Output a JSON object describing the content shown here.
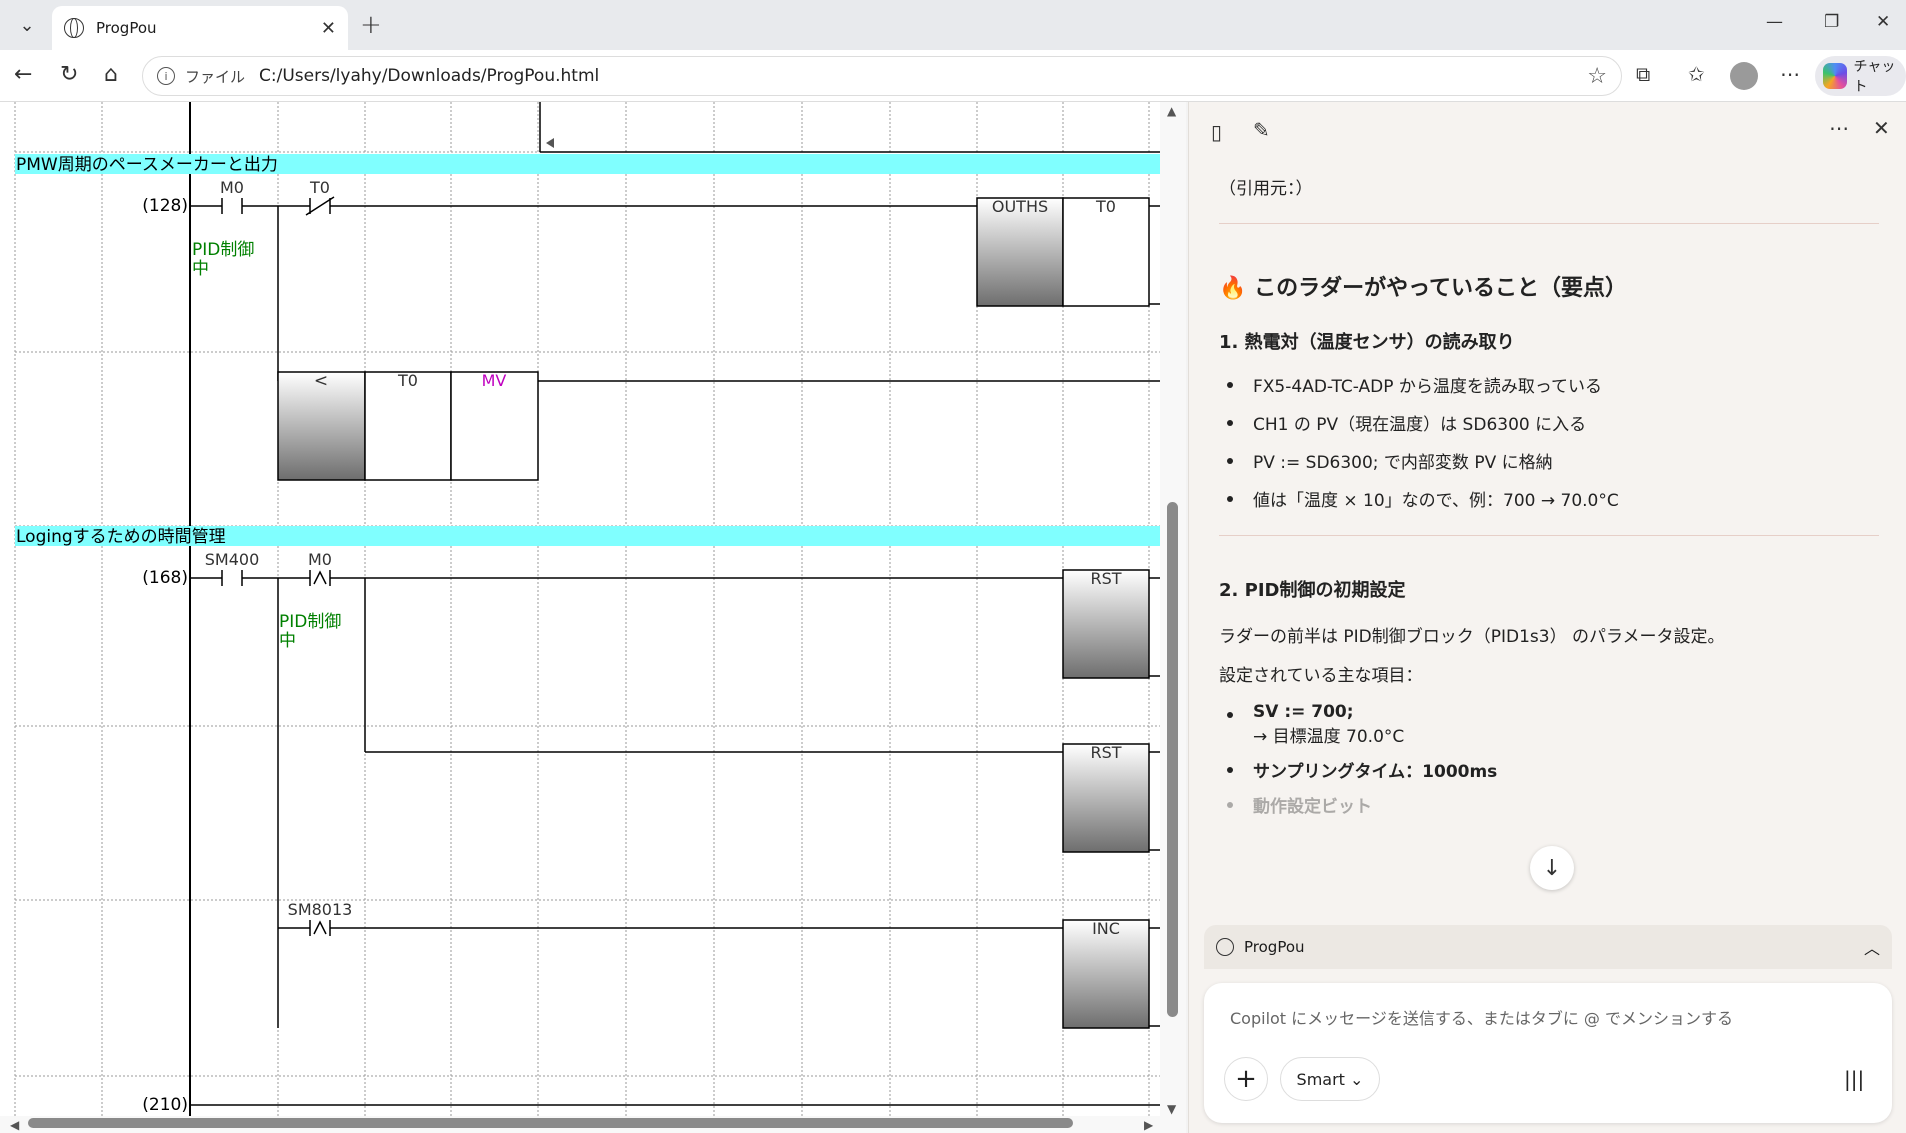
{
  "browser": {
    "tab_title": "ProgPou",
    "url_scheme": "ファイル",
    "url": "C:/Users/lyahy/Downloads/ProgPou.html",
    "chat_button_label": "チャット"
  },
  "ladder": {
    "sections": [
      {
        "title": "PMW周期のペースメーカーと出力"
      },
      {
        "title": "Logingするための時間管理"
      }
    ],
    "step_numbers": [
      "(128)",
      "(168)",
      "(210)"
    ],
    "contacts": {
      "m0_a": "M0",
      "t0_b": "T0",
      "sm400": "SM400",
      "m0_b": "M0",
      "sm8013": "SM8013"
    },
    "comments": {
      "pid_1_line1": "PID制御",
      "pid_1_line2": "中",
      "pid_2_line1": "PID制御",
      "pid_2_line2": "中"
    },
    "instructions": {
      "ouths": "OUTHS",
      "ouths_arg": "T0",
      "cmp": "<",
      "cmp_arg1": "T0",
      "cmp_arg2": "MV",
      "rst1": "RST",
      "rst2": "RST",
      "inc": "INC"
    },
    "colors": {
      "section_bg": "#80ffff",
      "comment_green": "#008000",
      "mv_magenta": "#c000c0"
    }
  },
  "copilot": {
    "citation": "（引用元：）",
    "heading": "このラダーがやっていること（要点）",
    "sec1_title": "1. 熱電対（温度センサ）の読み取り",
    "sec1_items": [
      "FX5-4AD-TC-ADP から温度を読み取っている",
      "CH1 の PV（現在温度）は SD6300 に入る",
      "PV := SD6300; で内部変数 PV に格納",
      "値は「温度 × 10」なので、例：700 → 70.0°C"
    ],
    "sec2_title": "2. PID制御の初期設定",
    "sec2_intro": "ラダーの前半は PID制御ブロック（PID1s3） のパラメータ設定。",
    "sec2_sub": "設定されている主な項目：",
    "sec2_item1": "SV := 700;",
    "sec2_item1_note": "→ 目標温度 70.0°C",
    "sec2_item2_label": "サンプリングタイム：",
    "sec2_item2_value": "1000ms",
    "sec2_item3": "動作設定ビット",
    "context_label": "ProgPou",
    "input_placeholder": "Copilot にメッセージを送信する、またはタブに @ でメンションする",
    "mode_label": "Smart"
  }
}
